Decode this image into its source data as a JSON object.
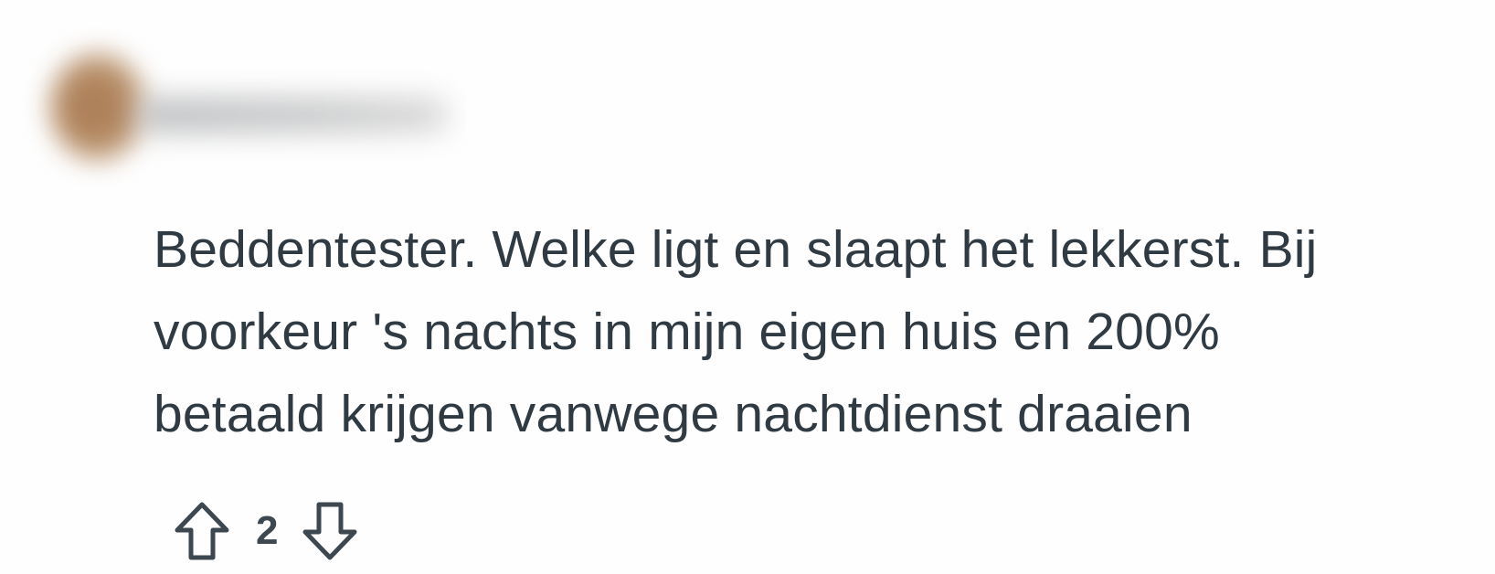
{
  "comment": {
    "body_lines": [
      "Beddentester. Welke ligt en slaapt het lekkerst. Bij",
      "voorkeur 's nachts in mijn eigen huis en 200%",
      "betaald krijgen vanwege nachtdienst draaien"
    ],
    "vote_count": "2"
  },
  "icons": {
    "upvote": "arrow-up-outline-icon",
    "downvote": "arrow-down-outline-icon"
  },
  "colors": {
    "text": "#2f3a42",
    "icon_stroke": "#3c4750",
    "background": "#fefefe"
  }
}
